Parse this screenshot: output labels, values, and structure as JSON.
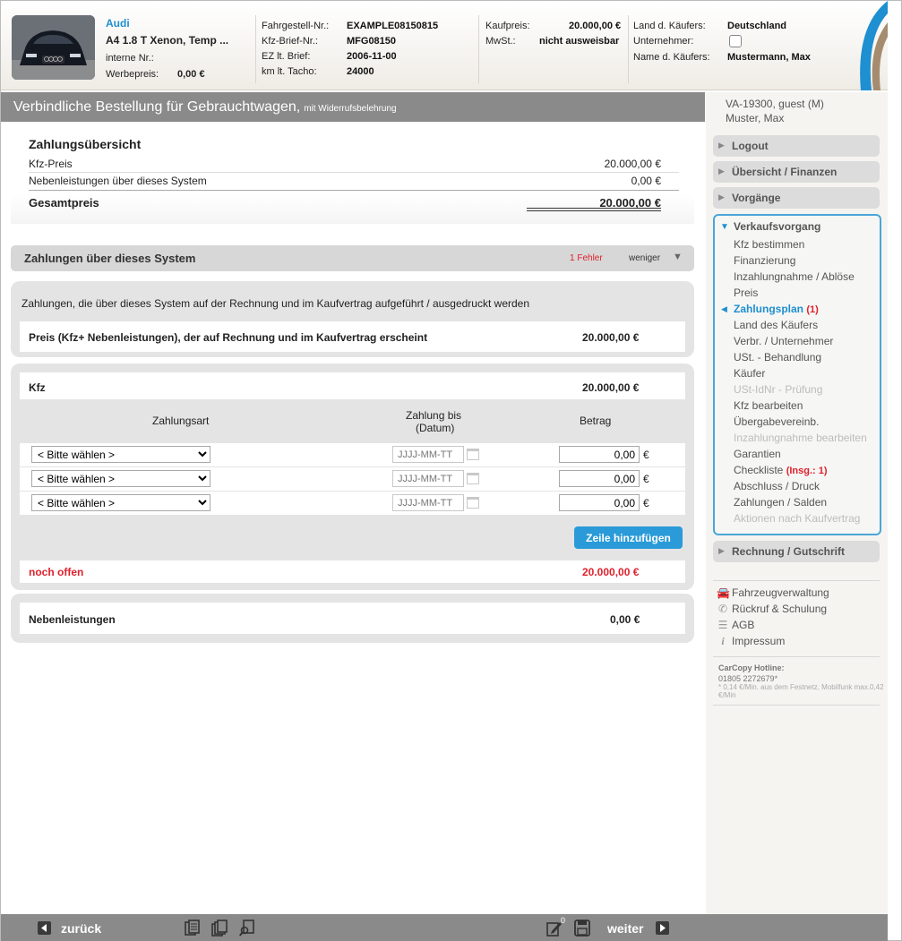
{
  "header": {
    "brand": "Audi",
    "model": "A4 1.8 T Xenon, Temp ...",
    "intern_label": "interne Nr.:",
    "werbe_label": "Werbepreis:",
    "werbe_value": "0,00 €",
    "fahrgestell_label": "Fahrgestell-Nr.:",
    "fahrgestell_value": "EXAMPLE08150815",
    "brief_label": "Kfz-Brief-Nr.:",
    "brief_value": "MFG08150",
    "ez_label": "EZ lt. Brief:",
    "ez_value": "2006-11-00",
    "km_label": "km lt. Tacho:",
    "km_value": "24000",
    "kaufpreis_label": "Kaufpreis:",
    "kaufpreis_value": "20.000,00 €",
    "mwst_label": "MwSt.:",
    "mwst_value": "nicht ausweisbar",
    "land_label": "Land d. Käufers:",
    "land_value": "Deutschland",
    "unternehmer_label": "Unternehmer:",
    "kaeufer_label": "Name d. Käufers:",
    "kaeufer_value": "Mustermann, Max"
  },
  "title": {
    "main": "Verbindliche Bestellung für Gebrauchtwagen,",
    "sub": "mit Widerrufsbelehrung"
  },
  "summary": {
    "title": "Zahlungsübersicht",
    "rows": [
      {
        "label": "Kfz-Preis",
        "value": "20.000,00 €"
      },
      {
        "label": "Nebenleistungen über dieses System",
        "value": "0,00 €"
      }
    ],
    "total_label": "Gesamtpreis",
    "total_value": "20.000,00 €"
  },
  "payments_bar": {
    "title": "Zahlungen über dieses System",
    "error": "1 Fehler",
    "toggle": "weniger"
  },
  "panel1": {
    "description": "Zahlungen, die über dieses System auf der Rechnung und im Kaufvertrag aufgeführt / ausgedruckt werden",
    "row_label": "Preis (Kfz+ Nebenleistungen), der auf Rechnung und im Kaufvertrag erscheint",
    "row_value": "20.000,00 €"
  },
  "panel2": {
    "kfz_label": "Kfz",
    "kfz_value": "20.000,00 €",
    "col_type": "Zahlungsart",
    "col_date_1": "Zahlung bis",
    "col_date_2": "(Datum)",
    "col_amount": "Betrag",
    "select_value": "< Bitte wählen >",
    "date_placeholder": "JJJJ-MM-TT",
    "amount_value": "0,00",
    "currency": "€",
    "add_button": "Zeile hinzufügen",
    "open_label": "noch offen",
    "open_value": "20.000,00 €"
  },
  "panel3": {
    "label": "Nebenleistungen",
    "value": "0,00 €"
  },
  "sidebar": {
    "user_line1": "VA-19300, guest (M)",
    "user_line2": "Muster, Max",
    "nav": [
      "Logout",
      "Übersicht / Finanzen",
      "Vorgänge"
    ],
    "active_group": "Verkaufsvorgang",
    "items": [
      "Kfz bestimmen",
      "Finanzierung",
      "Inzahlungnahme / Ablöse",
      "Preis",
      "Zahlungsplan",
      "Land des Käufers",
      "Verbr. / Unternehmer",
      "USt. - Behandlung",
      "Käufer",
      "USt-IdNr - Prüfung",
      "Kfz bearbeiten",
      "Übergabevereinb.",
      "Inzahlungnahme bearbeiten",
      "Garantien",
      "Checkliste",
      "Abschluss / Druck",
      "Zahlungen / Salden",
      "Aktionen nach Kaufvertrag"
    ],
    "zahlungsplan_badge": "(1)",
    "checkliste_badge": "(Insg.: 1)",
    "rechnung": "Rechnung / Gutschrift",
    "tools": [
      "Fahrzeugverwaltung",
      "Rückruf & Schulung",
      "AGB",
      "Impressum"
    ],
    "hotline_title": "CarCopy Hotline:",
    "hotline_number": "01805 2272679*",
    "hotline_note": "* 0,14 €/Min. aus dem Festnetz, Mobilfunk max.0,42 €/Min"
  },
  "footer": {
    "back": "zurück",
    "next": "weiter",
    "edit_badge": "0"
  },
  "colors": {
    "accent": "#2a9ad8",
    "error": "#e0202c",
    "bar": "#8a8a8a"
  }
}
